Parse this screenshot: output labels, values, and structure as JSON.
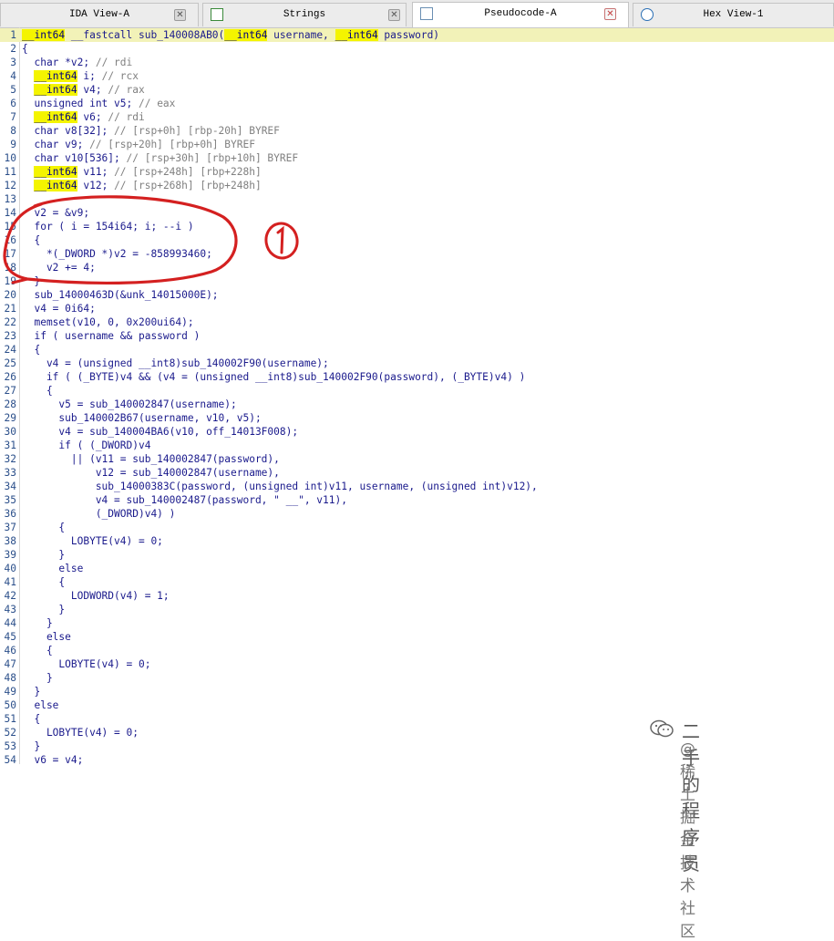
{
  "tabs": [
    {
      "label": "IDA View-A",
      "icon": "ida-view-icon",
      "active": false
    },
    {
      "label": "Strings",
      "icon": "strings-icon",
      "active": false
    },
    {
      "label": "Pseudocode-A",
      "icon": "pseudocode-icon",
      "active": true
    },
    {
      "label": "Hex View-1",
      "icon": "hex-view-icon",
      "active": false
    }
  ],
  "lines": [
    {
      "n": "1",
      "t": "__int64 __fastcall sub_140008AB0(__int64 username, __int64 password)"
    },
    {
      "n": "2",
      "t": "{"
    },
    {
      "n": "3",
      "t": "  char *v2; // rdi"
    },
    {
      "n": "4",
      "t": "  __int64 i; // rcx"
    },
    {
      "n": "5",
      "t": "  __int64 v4; // rax"
    },
    {
      "n": "6",
      "t": "  unsigned int v5; // eax"
    },
    {
      "n": "7",
      "t": "  __int64 v6; // rdi"
    },
    {
      "n": "8",
      "t": "  char v8[32]; // [rsp+0h] [rbp-20h] BYREF"
    },
    {
      "n": "9",
      "t": "  char v9; // [rsp+20h] [rbp+0h] BYREF"
    },
    {
      "n": "10",
      "t": "  char v10[536]; // [rsp+30h] [rbp+10h] BYREF"
    },
    {
      "n": "11",
      "t": "  __int64 v11; // [rsp+248h] [rbp+228h]"
    },
    {
      "n": "12",
      "t": "  __int64 v12; // [rsp+268h] [rbp+248h]"
    },
    {
      "n": "13",
      "t": ""
    },
    {
      "n": "14",
      "t": "  v2 = &v9;"
    },
    {
      "n": "15",
      "t": "  for ( i = 154i64; i; --i )"
    },
    {
      "n": "16",
      "t": "  {"
    },
    {
      "n": "17",
      "t": "    *(_DWORD *)v2 = -858993460;"
    },
    {
      "n": "18",
      "t": "    v2 += 4;"
    },
    {
      "n": "19",
      "t": "  }"
    },
    {
      "n": "20",
      "t": "  sub_14000463D(&unk_14015000E);"
    },
    {
      "n": "21",
      "t": "  v4 = 0i64;"
    },
    {
      "n": "22",
      "t": "  memset(v10, 0, 0x200ui64);"
    },
    {
      "n": "23",
      "t": "  if ( username && password )"
    },
    {
      "n": "24",
      "t": "  {"
    },
    {
      "n": "25",
      "t": "    v4 = (unsigned __int8)sub_140002F90(username);"
    },
    {
      "n": "26",
      "t": "    if ( (_BYTE)v4 && (v4 = (unsigned __int8)sub_140002F90(password), (_BYTE)v4) )"
    },
    {
      "n": "27",
      "t": "    {"
    },
    {
      "n": "28",
      "t": "      v5 = sub_140002847(username);"
    },
    {
      "n": "29",
      "t": "      sub_140002B67(username, v10, v5);"
    },
    {
      "n": "30",
      "t": "      v4 = sub_140004BA6(v10, off_14013F008);"
    },
    {
      "n": "31",
      "t": "      if ( (_DWORD)v4"
    },
    {
      "n": "32",
      "t": "        || (v11 = sub_140002847(password),"
    },
    {
      "n": "33",
      "t": "            v12 = sub_140002847(username),"
    },
    {
      "n": "34",
      "t": "            sub_14000383C(password, (unsigned int)v11, username, (unsigned int)v12),"
    },
    {
      "n": "35",
      "t": "            v4 = sub_140002487(password, \" __\", v11),"
    },
    {
      "n": "36",
      "t": "            (_DWORD)v4) )"
    },
    {
      "n": "37",
      "t": "      {"
    },
    {
      "n": "38",
      "t": "        LOBYTE(v4) = 0;"
    },
    {
      "n": "39",
      "t": "      }"
    },
    {
      "n": "40",
      "t": "      else"
    },
    {
      "n": "41",
      "t": "      {"
    },
    {
      "n": "42",
      "t": "        LODWORD(v4) = 1;"
    },
    {
      "n": "43",
      "t": "      }"
    },
    {
      "n": "44",
      "t": "    }"
    },
    {
      "n": "45",
      "t": "    else"
    },
    {
      "n": "46",
      "t": "    {"
    },
    {
      "n": "47",
      "t": "      LOBYTE(v4) = 0;"
    },
    {
      "n": "48",
      "t": "    }"
    },
    {
      "n": "49",
      "t": "  }"
    },
    {
      "n": "50",
      "t": "  else"
    },
    {
      "n": "51",
      "t": "  {"
    },
    {
      "n": "52",
      "t": "    LOBYTE(v4) = 0;"
    },
    {
      "n": "53",
      "t": "  }"
    },
    {
      "n": "54",
      "t": "  v6 = v4;"
    }
  ],
  "annotation": {
    "label": "①",
    "color": "#d42020"
  },
  "watermark": {
    "line1": "二手的程序员",
    "line2": "@稀土掘金技术社区"
  }
}
